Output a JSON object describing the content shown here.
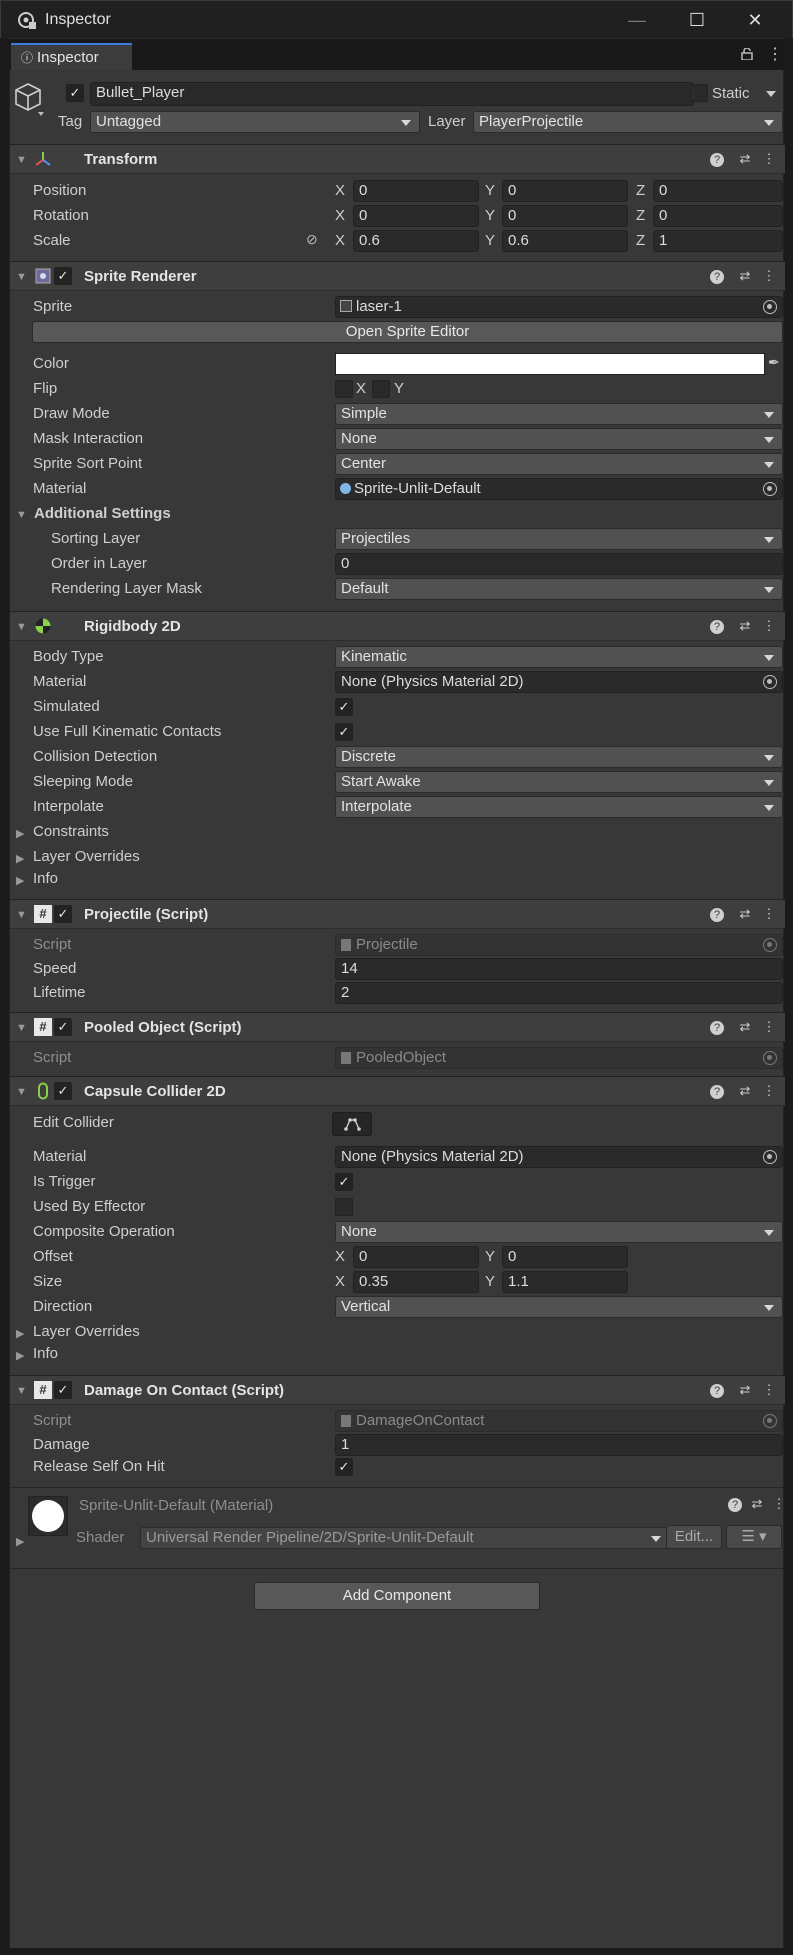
{
  "window": {
    "title": "Inspector"
  },
  "tab": {
    "label": "Inspector"
  },
  "object": {
    "name": "Bullet_Player",
    "static_label": "Static",
    "tag_label": "Tag",
    "tag_value": "Untagged",
    "layer_label": "Layer",
    "layer_value": "PlayerProjectile"
  },
  "transform": {
    "title": "Transform",
    "position": {
      "label": "Position",
      "x": "0",
      "y": "0",
      "z": "0"
    },
    "rotation": {
      "label": "Rotation",
      "x": "0",
      "y": "0",
      "z": "0"
    },
    "scale": {
      "label": "Scale",
      "x": "0.6",
      "y": "0.6",
      "z": "1"
    }
  },
  "axes": {
    "x": "X",
    "y": "Y",
    "z": "Z"
  },
  "sprite_renderer": {
    "title": "Sprite Renderer",
    "sprite_label": "Sprite",
    "sprite_value": "laser-1",
    "open_editor": "Open Sprite Editor",
    "color_label": "Color",
    "color_value": "#ffffff",
    "flip_label": "Flip",
    "flip_x": "X",
    "flip_y": "Y",
    "draw_mode_label": "Draw Mode",
    "draw_mode_value": "Simple",
    "mask_label": "Mask Interaction",
    "mask_value": "None",
    "sort_point_label": "Sprite Sort Point",
    "sort_point_value": "Center",
    "material_label": "Material",
    "material_value": "Sprite-Unlit-Default",
    "additional_label": "Additional Settings",
    "sorting_layer_label": "Sorting Layer",
    "sorting_layer_value": "Projectiles",
    "order_label": "Order in Layer",
    "order_value": "0",
    "rendering_mask_label": "Rendering Layer Mask",
    "rendering_mask_value": "Default"
  },
  "rigidbody": {
    "title": "Rigidbody 2D",
    "body_type_label": "Body Type",
    "body_type_value": "Kinematic",
    "material_label": "Material",
    "material_value": "None (Physics Material 2D)",
    "simulated_label": "Simulated",
    "full_contacts_label": "Use Full Kinematic Contacts",
    "collision_label": "Collision Detection",
    "collision_value": "Discrete",
    "sleeping_label": "Sleeping Mode",
    "sleeping_value": "Start Awake",
    "interpolate_label": "Interpolate",
    "interpolate_value": "Interpolate",
    "constraints_label": "Constraints",
    "overrides_label": "Layer Overrides",
    "info_label": "Info"
  },
  "projectile": {
    "title": "Projectile (Script)",
    "script_label": "Script",
    "script_value": "Projectile",
    "speed_label": "Speed",
    "speed_value": "14",
    "lifetime_label": "Lifetime",
    "lifetime_value": "2"
  },
  "pooled": {
    "title": "Pooled Object (Script)",
    "script_label": "Script",
    "script_value": "PooledObject"
  },
  "capsule": {
    "title": "Capsule Collider 2D",
    "edit_label": "Edit Collider",
    "material_label": "Material",
    "material_value": "None (Physics Material 2D)",
    "trigger_label": "Is Trigger",
    "effector_label": "Used By Effector",
    "composite_label": "Composite Operation",
    "composite_value": "None",
    "offset_label": "Offset",
    "offset_x": "0",
    "offset_y": "0",
    "size_label": "Size",
    "size_x": "0.35",
    "size_y": "1.1",
    "direction_label": "Direction",
    "direction_value": "Vertical",
    "overrides_label": "Layer Overrides",
    "info_label": "Info"
  },
  "damage": {
    "title": "Damage On Contact (Script)",
    "script_label": "Script",
    "script_value": "DamageOnContact",
    "damage_label": "Damage",
    "damage_value": "1",
    "release_label": "Release Self On Hit"
  },
  "material": {
    "title": "Sprite-Unlit-Default (Material)",
    "shader_label": "Shader",
    "shader_value": "Universal Render Pipeline/2D/Sprite-Unlit-Default",
    "edit_label": "Edit..."
  },
  "add_component": "Add Component",
  "colors": {
    "accent": "#3d7de0",
    "panel": "#383838",
    "header": "#3e3e3e"
  }
}
